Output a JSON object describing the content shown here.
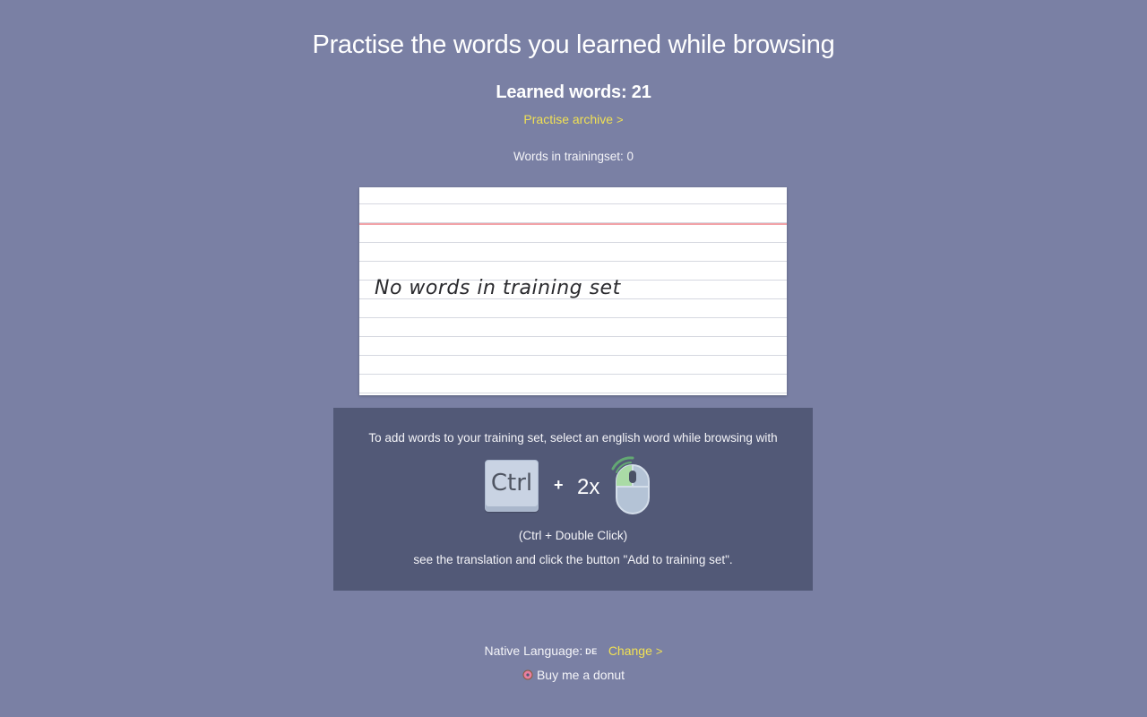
{
  "page": {
    "title": "Practise the words you learned while browsing"
  },
  "stats": {
    "learned_text": "Learned words: 21",
    "archive_link": "Practise archive",
    "archive_chevron": ">",
    "trainingset_text": "Words in trainingset: 0"
  },
  "card": {
    "text": "No words in training set"
  },
  "instructions": {
    "line1": "To add words to your training set, select an english word while browsing with",
    "ctrl_key": "Ctrl",
    "plus": "+",
    "times": "2x",
    "shortcut_text": "(Ctrl + Double Click)",
    "line3": "see the translation and click the button \"Add to training set\"."
  },
  "footer": {
    "native_label": "Native Language:",
    "language_code": "DE",
    "change_link": "Change",
    "change_chevron": ">",
    "donut_link": "Buy me a donut"
  },
  "colors": {
    "background": "#7a80a4",
    "panel": "#525977",
    "link": "#f0e054",
    "card_red_line": "#f2a3a8"
  },
  "icons": {
    "mouse": "mouse-double-click-icon",
    "donut": "donut-icon",
    "chevron": "chevron-right-icon"
  }
}
